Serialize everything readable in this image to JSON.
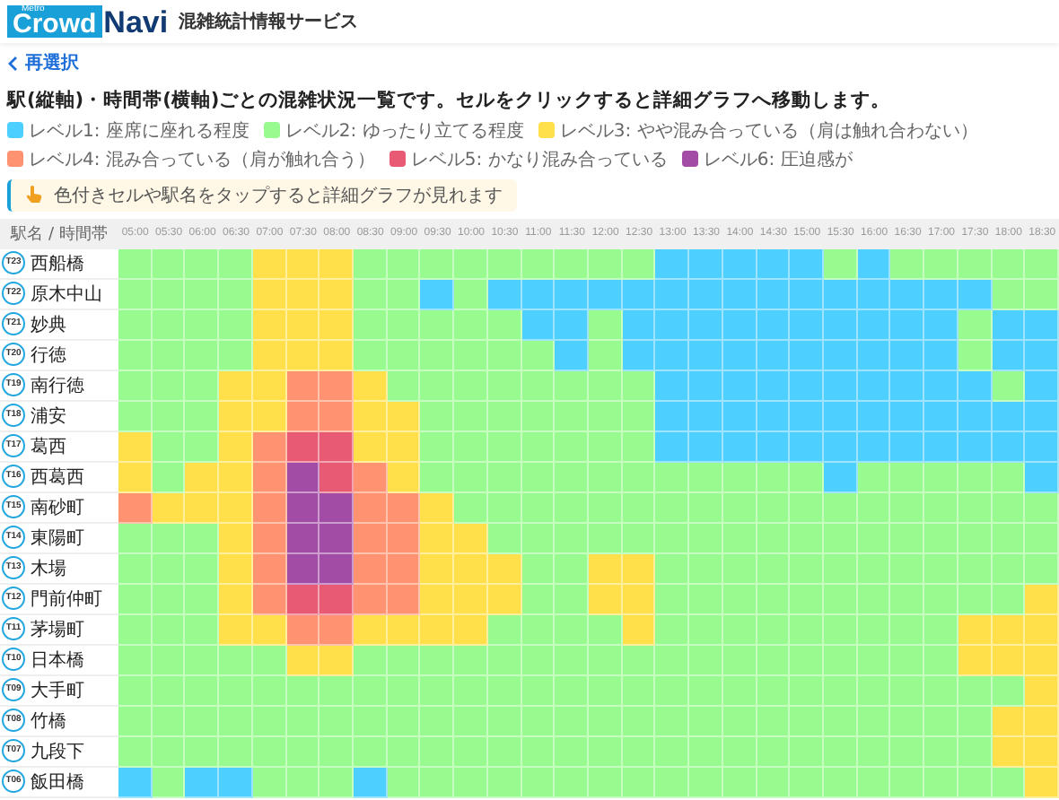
{
  "header": {
    "logo_tag": "Metro",
    "logo_main": "Crowd",
    "logo_accent": "Navi",
    "service_name": "混雑統計情報サービス"
  },
  "back_link": "再選択",
  "instruction": "駅(縦軸)・時間帯(横軸)ごとの混雑状況一覧です。セルをクリックすると詳細グラフへ移動します。",
  "legend": [
    {
      "label": "レベル1: 座席に座れる程度",
      "color": "#4dcfff"
    },
    {
      "label": "レベル2: ゆったり立てる程度",
      "color": "#98fb8f"
    },
    {
      "label": "レベル3: やや混み合っている（肩は触れ合わない）",
      "color": "#ffe04b"
    },
    {
      "label": "レベル4: 混み合っている（肩が触れ合う）",
      "color": "#ff9270"
    },
    {
      "label": "レベル5: かなり混み合っている",
      "color": "#e85a73"
    },
    {
      "label": "レベル6: 圧迫感が",
      "color": "#a24ca6"
    }
  ],
  "hint": "色付きセルや駅名をタップすると詳細グラフが見れます",
  "table": {
    "corner": "駅名 / 時間帯",
    "times": [
      "05:00",
      "05:30",
      "06:00",
      "06:30",
      "07:00",
      "07:30",
      "08:00",
      "08:30",
      "09:00",
      "09:30",
      "10:00",
      "10:30",
      "11:00",
      "11:30",
      "12:00",
      "12:30",
      "13:00",
      "13:30",
      "14:00",
      "14:30",
      "15:00",
      "15:30",
      "16:00",
      "16:30",
      "17:00",
      "17:30",
      "18:00",
      "18:30"
    ],
    "rows": [
      {
        "code": "T23",
        "station": "西船橋",
        "cells": [
          {
            "color": "#98fb8f"
          },
          {
            "color": "#98fb8f"
          },
          {
            "color": "#98fb8f"
          },
          {
            "color": "#98fb8f"
          },
          {
            "color": "#ffe04b"
          },
          {
            "color": "#ffe04b"
          },
          {
            "color": "#ffe04b"
          },
          {
            "color": "#98fb8f"
          },
          {
            "color": "#98fb8f"
          },
          {
            "color": "#98fb8f"
          },
          {
            "color": "#98fb8f"
          },
          {
            "color": "#98fb8f"
          },
          {
            "color": "#98fb8f"
          },
          {
            "color": "#98fb8f"
          },
          {
            "color": "#98fb8f"
          },
          {
            "color": "#98fb8f"
          },
          {
            "color": "#4dcfff"
          },
          {
            "color": "#4dcfff"
          },
          {
            "color": "#4dcfff"
          },
          {
            "color": "#4dcfff"
          },
          {
            "color": "#4dcfff"
          },
          {
            "color": "#98fb8f"
          },
          {
            "color": "#4dcfff"
          },
          {
            "color": "#98fb8f"
          },
          {
            "color": "#98fb8f"
          },
          {
            "color": "#98fb8f"
          },
          {
            "color": "#98fb8f"
          },
          {
            "color": "#98fb8f"
          }
        ]
      },
      {
        "code": "T22",
        "station": "原木中山",
        "cells": [
          {
            "color": "#98fb8f"
          },
          {
            "color": "#98fb8f"
          },
          {
            "color": "#98fb8f"
          },
          {
            "color": "#98fb8f"
          },
          {
            "color": "#ffe04b"
          },
          {
            "color": "#ffe04b"
          },
          {
            "color": "#ffe04b"
          },
          {
            "color": "#98fb8f"
          },
          {
            "color": "#98fb8f"
          },
          {
            "color": "#4dcfff"
          },
          {
            "color": "#98fb8f"
          },
          {
            "color": "#4dcfff"
          },
          {
            "color": "#4dcfff"
          },
          {
            "color": "#4dcfff"
          },
          {
            "color": "#4dcfff"
          },
          {
            "color": "#4dcfff"
          },
          {
            "color": "#4dcfff"
          },
          {
            "color": "#4dcfff"
          },
          {
            "color": "#4dcfff"
          },
          {
            "color": "#4dcfff"
          },
          {
            "color": "#4dcfff"
          },
          {
            "color": "#4dcfff"
          },
          {
            "color": "#4dcfff"
          },
          {
            "color": "#4dcfff"
          },
          {
            "color": "#4dcfff"
          },
          {
            "color": "#4dcfff"
          },
          {
            "color": "#98fb8f"
          },
          {
            "color": "#98fb8f"
          }
        ]
      },
      {
        "code": "T21",
        "station": "妙典",
        "cells": [
          {
            "color": "#98fb8f"
          },
          {
            "color": "#98fb8f"
          },
          {
            "color": "#98fb8f"
          },
          {
            "color": "#98fb8f"
          },
          {
            "color": "#ffe04b"
          },
          {
            "color": "#ffe04b"
          },
          {
            "color": "#ffe04b"
          },
          {
            "color": "#98fb8f"
          },
          {
            "color": "#98fb8f"
          },
          {
            "color": "#98fb8f"
          },
          {
            "color": "#98fb8f"
          },
          {
            "color": "#98fb8f"
          },
          {
            "color": "#4dcfff"
          },
          {
            "color": "#4dcfff"
          },
          {
            "color": "#98fb8f"
          },
          {
            "color": "#4dcfff"
          },
          {
            "color": "#4dcfff"
          },
          {
            "color": "#4dcfff"
          },
          {
            "color": "#4dcfff"
          },
          {
            "color": "#4dcfff"
          },
          {
            "color": "#4dcfff"
          },
          {
            "color": "#4dcfff"
          },
          {
            "color": "#4dcfff"
          },
          {
            "color": "#4dcfff"
          },
          {
            "color": "#4dcfff"
          },
          {
            "color": "#98fb8f"
          },
          {
            "color": "#4dcfff"
          },
          {
            "color": "#4dcfff"
          }
        ]
      },
      {
        "code": "T20",
        "station": "行徳",
        "cells": [
          {
            "color": "#98fb8f"
          },
          {
            "color": "#98fb8f"
          },
          {
            "color": "#98fb8f"
          },
          {
            "color": "#98fb8f"
          },
          {
            "color": "#ffe04b"
          },
          {
            "color": "#ffe04b"
          },
          {
            "color": "#ffe04b"
          },
          {
            "color": "#98fb8f"
          },
          {
            "color": "#98fb8f"
          },
          {
            "color": "#98fb8f"
          },
          {
            "color": "#98fb8f"
          },
          {
            "color": "#98fb8f"
          },
          {
            "color": "#98fb8f"
          },
          {
            "color": "#4dcfff"
          },
          {
            "color": "#98fb8f"
          },
          {
            "color": "#4dcfff"
          },
          {
            "color": "#4dcfff"
          },
          {
            "color": "#4dcfff"
          },
          {
            "color": "#4dcfff"
          },
          {
            "color": "#4dcfff"
          },
          {
            "color": "#4dcfff"
          },
          {
            "color": "#4dcfff"
          },
          {
            "color": "#4dcfff"
          },
          {
            "color": "#4dcfff"
          },
          {
            "color": "#4dcfff"
          },
          {
            "color": "#98fb8f"
          },
          {
            "color": "#4dcfff"
          },
          {
            "color": "#4dcfff"
          }
        ]
      },
      {
        "code": "T19",
        "station": "南行徳",
        "cells": [
          {
            "color": "#98fb8f"
          },
          {
            "color": "#98fb8f"
          },
          {
            "color": "#98fb8f"
          },
          {
            "color": "#ffe04b"
          },
          {
            "color": "#ffe04b"
          },
          {
            "color": "#ff9270"
          },
          {
            "color": "#ff9270"
          },
          {
            "color": "#ffe04b"
          },
          {
            "color": "#98fb8f"
          },
          {
            "color": "#98fb8f"
          },
          {
            "color": "#98fb8f"
          },
          {
            "color": "#98fb8f"
          },
          {
            "color": "#98fb8f"
          },
          {
            "color": "#98fb8f"
          },
          {
            "color": "#98fb8f"
          },
          {
            "color": "#98fb8f"
          },
          {
            "color": "#4dcfff"
          },
          {
            "color": "#4dcfff"
          },
          {
            "color": "#4dcfff"
          },
          {
            "color": "#4dcfff"
          },
          {
            "color": "#4dcfff"
          },
          {
            "color": "#4dcfff"
          },
          {
            "color": "#4dcfff"
          },
          {
            "color": "#4dcfff"
          },
          {
            "color": "#4dcfff"
          },
          {
            "color": "#4dcfff"
          },
          {
            "color": "#98fb8f"
          },
          {
            "color": "#4dcfff"
          }
        ]
      },
      {
        "code": "T18",
        "station": "浦安",
        "cells": [
          {
            "color": "#98fb8f"
          },
          {
            "color": "#98fb8f"
          },
          {
            "color": "#98fb8f"
          },
          {
            "color": "#ffe04b"
          },
          {
            "color": "#ffe04b"
          },
          {
            "color": "#ff9270"
          },
          {
            "color": "#ff9270"
          },
          {
            "color": "#ffe04b"
          },
          {
            "color": "#ffe04b"
          },
          {
            "color": "#98fb8f"
          },
          {
            "color": "#98fb8f"
          },
          {
            "color": "#98fb8f"
          },
          {
            "color": "#98fb8f"
          },
          {
            "color": "#98fb8f"
          },
          {
            "color": "#98fb8f"
          },
          {
            "color": "#98fb8f"
          },
          {
            "color": "#4dcfff"
          },
          {
            "color": "#4dcfff"
          },
          {
            "color": "#4dcfff"
          },
          {
            "color": "#4dcfff"
          },
          {
            "color": "#4dcfff"
          },
          {
            "color": "#4dcfff"
          },
          {
            "color": "#4dcfff"
          },
          {
            "color": "#4dcfff"
          },
          {
            "color": "#4dcfff"
          },
          {
            "color": "#4dcfff"
          },
          {
            "color": "#4dcfff"
          },
          {
            "color": "#4dcfff"
          }
        ]
      },
      {
        "code": "T17",
        "station": "葛西",
        "cells": [
          {
            "color": "#ffe04b"
          },
          {
            "color": "#98fb8f"
          },
          {
            "color": "#98fb8f"
          },
          {
            "color": "#ffe04b"
          },
          {
            "color": "#ff9270"
          },
          {
            "color": "#e85a73"
          },
          {
            "color": "#e85a73"
          },
          {
            "color": "#ffe04b"
          },
          {
            "color": "#ffe04b"
          },
          {
            "color": "#98fb8f"
          },
          {
            "color": "#98fb8f"
          },
          {
            "color": "#98fb8f"
          },
          {
            "color": "#98fb8f"
          },
          {
            "color": "#98fb8f"
          },
          {
            "color": "#98fb8f"
          },
          {
            "color": "#98fb8f"
          },
          {
            "color": "#4dcfff"
          },
          {
            "color": "#4dcfff"
          },
          {
            "color": "#4dcfff"
          },
          {
            "color": "#4dcfff"
          },
          {
            "color": "#4dcfff"
          },
          {
            "color": "#4dcfff"
          },
          {
            "color": "#4dcfff"
          },
          {
            "color": "#4dcfff"
          },
          {
            "color": "#4dcfff"
          },
          {
            "color": "#4dcfff"
          },
          {
            "color": "#4dcfff"
          },
          {
            "color": "#4dcfff"
          }
        ]
      },
      {
        "code": "T16",
        "station": "西葛西",
        "cells": [
          {
            "color": "#ffe04b"
          },
          {
            "color": "#98fb8f"
          },
          {
            "color": "#ffe04b"
          },
          {
            "color": "#ffe04b"
          },
          {
            "color": "#ff9270"
          },
          {
            "color": "#a24ca6"
          },
          {
            "color": "#e85a73"
          },
          {
            "color": "#ff9270"
          },
          {
            "color": "#ffe04b"
          },
          {
            "color": "#98fb8f"
          },
          {
            "color": "#98fb8f"
          },
          {
            "color": "#98fb8f"
          },
          {
            "color": "#98fb8f"
          },
          {
            "color": "#98fb8f"
          },
          {
            "color": "#98fb8f"
          },
          {
            "color": "#98fb8f"
          },
          {
            "color": "#98fb8f"
          },
          {
            "color": "#98fb8f"
          },
          {
            "color": "#98fb8f"
          },
          {
            "color": "#98fb8f"
          },
          {
            "color": "#98fb8f"
          },
          {
            "color": "#4dcfff"
          },
          {
            "color": "#98fb8f"
          },
          {
            "color": "#98fb8f"
          },
          {
            "color": "#98fb8f"
          },
          {
            "color": "#98fb8f"
          },
          {
            "color": "#98fb8f"
          },
          {
            "color": "#4dcfff"
          }
        ]
      },
      {
        "code": "T15",
        "station": "南砂町",
        "cells": [
          {
            "color": "#ff9270"
          },
          {
            "color": "#ffe04b"
          },
          {
            "color": "#ffe04b"
          },
          {
            "color": "#ffe04b"
          },
          {
            "color": "#ff9270"
          },
          {
            "color": "#a24ca6"
          },
          {
            "color": "#a24ca6"
          },
          {
            "color": "#ff9270"
          },
          {
            "color": "#ff9270"
          },
          {
            "color": "#ffe04b"
          },
          {
            "color": "#98fb8f"
          },
          {
            "color": "#98fb8f"
          },
          {
            "color": "#98fb8f"
          },
          {
            "color": "#98fb8f"
          },
          {
            "color": "#98fb8f"
          },
          {
            "color": "#98fb8f"
          },
          {
            "color": "#98fb8f"
          },
          {
            "color": "#98fb8f"
          },
          {
            "color": "#98fb8f"
          },
          {
            "color": "#98fb8f"
          },
          {
            "color": "#98fb8f"
          },
          {
            "color": "#98fb8f"
          },
          {
            "color": "#98fb8f"
          },
          {
            "color": "#98fb8f"
          },
          {
            "color": "#98fb8f"
          },
          {
            "color": "#98fb8f"
          },
          {
            "color": "#98fb8f"
          },
          {
            "color": "#98fb8f"
          }
        ]
      },
      {
        "code": "T14",
        "station": "東陽町",
        "cells": [
          {
            "color": "#98fb8f"
          },
          {
            "color": "#98fb8f"
          },
          {
            "color": "#98fb8f"
          },
          {
            "color": "#ffe04b"
          },
          {
            "color": "#ff9270"
          },
          {
            "color": "#a24ca6"
          },
          {
            "color": "#a24ca6"
          },
          {
            "color": "#ff9270"
          },
          {
            "color": "#ff9270"
          },
          {
            "color": "#ffe04b"
          },
          {
            "color": "#ffe04b"
          },
          {
            "color": "#98fb8f"
          },
          {
            "color": "#98fb8f"
          },
          {
            "color": "#98fb8f"
          },
          {
            "color": "#98fb8f"
          },
          {
            "color": "#98fb8f"
          },
          {
            "color": "#98fb8f"
          },
          {
            "color": "#98fb8f"
          },
          {
            "color": "#98fb8f"
          },
          {
            "color": "#98fb8f"
          },
          {
            "color": "#98fb8f"
          },
          {
            "color": "#98fb8f"
          },
          {
            "color": "#98fb8f"
          },
          {
            "color": "#98fb8f"
          },
          {
            "color": "#98fb8f"
          },
          {
            "color": "#98fb8f"
          },
          {
            "color": "#98fb8f"
          },
          {
            "color": "#98fb8f"
          }
        ]
      },
      {
        "code": "T13",
        "station": "木場",
        "cells": [
          {
            "color": "#98fb8f"
          },
          {
            "color": "#98fb8f"
          },
          {
            "color": "#98fb8f"
          },
          {
            "color": "#ffe04b"
          },
          {
            "color": "#ff9270"
          },
          {
            "color": "#a24ca6"
          },
          {
            "color": "#a24ca6"
          },
          {
            "color": "#ff9270"
          },
          {
            "color": "#ff9270"
          },
          {
            "color": "#ffe04b"
          },
          {
            "color": "#ffe04b"
          },
          {
            "color": "#ffe04b"
          },
          {
            "color": "#98fb8f"
          },
          {
            "color": "#98fb8f"
          },
          {
            "color": "#ffe04b"
          },
          {
            "color": "#ffe04b"
          },
          {
            "color": "#98fb8f"
          },
          {
            "color": "#98fb8f"
          },
          {
            "color": "#98fb8f"
          },
          {
            "color": "#98fb8f"
          },
          {
            "color": "#98fb8f"
          },
          {
            "color": "#98fb8f"
          },
          {
            "color": "#98fb8f"
          },
          {
            "color": "#98fb8f"
          },
          {
            "color": "#98fb8f"
          },
          {
            "color": "#98fb8f"
          },
          {
            "color": "#98fb8f"
          },
          {
            "color": "#98fb8f"
          }
        ]
      },
      {
        "code": "T12",
        "station": "門前仲町",
        "cells": [
          {
            "color": "#98fb8f"
          },
          {
            "color": "#98fb8f"
          },
          {
            "color": "#98fb8f"
          },
          {
            "color": "#ffe04b"
          },
          {
            "color": "#ff9270"
          },
          {
            "color": "#e85a73"
          },
          {
            "color": "#e85a73"
          },
          {
            "color": "#ff9270"
          },
          {
            "color": "#ff9270"
          },
          {
            "color": "#ffe04b"
          },
          {
            "color": "#ffe04b"
          },
          {
            "color": "#ffe04b"
          },
          {
            "color": "#98fb8f"
          },
          {
            "color": "#98fb8f"
          },
          {
            "color": "#ffe04b"
          },
          {
            "color": "#ffe04b"
          },
          {
            "color": "#98fb8f"
          },
          {
            "color": "#98fb8f"
          },
          {
            "color": "#98fb8f"
          },
          {
            "color": "#98fb8f"
          },
          {
            "color": "#98fb8f"
          },
          {
            "color": "#98fb8f"
          },
          {
            "color": "#98fb8f"
          },
          {
            "color": "#98fb8f"
          },
          {
            "color": "#98fb8f"
          },
          {
            "color": "#98fb8f"
          },
          {
            "color": "#98fb8f"
          },
          {
            "color": "#ffe04b"
          }
        ]
      },
      {
        "code": "T11",
        "station": "茅場町",
        "cells": [
          {
            "color": "#98fb8f"
          },
          {
            "color": "#98fb8f"
          },
          {
            "color": "#98fb8f"
          },
          {
            "color": "#ffe04b"
          },
          {
            "color": "#ffe04b"
          },
          {
            "color": "#ff9270"
          },
          {
            "color": "#ff9270"
          },
          {
            "color": "#ffe04b"
          },
          {
            "color": "#ffe04b"
          },
          {
            "color": "#ffe04b"
          },
          {
            "color": "#ffe04b"
          },
          {
            "color": "#98fb8f"
          },
          {
            "color": "#98fb8f"
          },
          {
            "color": "#98fb8f"
          },
          {
            "color": "#98fb8f"
          },
          {
            "color": "#ffe04b"
          },
          {
            "color": "#98fb8f"
          },
          {
            "color": "#98fb8f"
          },
          {
            "color": "#98fb8f"
          },
          {
            "color": "#98fb8f"
          },
          {
            "color": "#98fb8f"
          },
          {
            "color": "#98fb8f"
          },
          {
            "color": "#98fb8f"
          },
          {
            "color": "#98fb8f"
          },
          {
            "color": "#98fb8f"
          },
          {
            "color": "#ffe04b"
          },
          {
            "color": "#ffe04b"
          },
          {
            "color": "#ffe04b"
          }
        ]
      },
      {
        "code": "T10",
        "station": "日本橋",
        "cells": [
          {
            "color": "#98fb8f"
          },
          {
            "color": "#98fb8f"
          },
          {
            "color": "#98fb8f"
          },
          {
            "color": "#98fb8f"
          },
          {
            "color": "#98fb8f"
          },
          {
            "color": "#ffe04b"
          },
          {
            "color": "#ffe04b"
          },
          {
            "color": "#98fb8f"
          },
          {
            "color": "#98fb8f"
          },
          {
            "color": "#98fb8f"
          },
          {
            "color": "#98fb8f"
          },
          {
            "color": "#98fb8f"
          },
          {
            "color": "#98fb8f"
          },
          {
            "color": "#98fb8f"
          },
          {
            "color": "#98fb8f"
          },
          {
            "color": "#98fb8f"
          },
          {
            "color": "#98fb8f"
          },
          {
            "color": "#98fb8f"
          },
          {
            "color": "#98fb8f"
          },
          {
            "color": "#98fb8f"
          },
          {
            "color": "#98fb8f"
          },
          {
            "color": "#98fb8f"
          },
          {
            "color": "#98fb8f"
          },
          {
            "color": "#98fb8f"
          },
          {
            "color": "#98fb8f"
          },
          {
            "color": "#ffe04b"
          },
          {
            "color": "#ffe04b"
          },
          {
            "color": "#ffe04b"
          }
        ]
      },
      {
        "code": "T09",
        "station": "大手町",
        "cells": [
          {
            "color": "#98fb8f"
          },
          {
            "color": "#98fb8f"
          },
          {
            "color": "#98fb8f"
          },
          {
            "color": "#98fb8f"
          },
          {
            "color": "#98fb8f"
          },
          {
            "color": "#98fb8f"
          },
          {
            "color": "#98fb8f"
          },
          {
            "color": "#98fb8f"
          },
          {
            "color": "#98fb8f"
          },
          {
            "color": "#98fb8f"
          },
          {
            "color": "#98fb8f"
          },
          {
            "color": "#98fb8f"
          },
          {
            "color": "#98fb8f"
          },
          {
            "color": "#98fb8f"
          },
          {
            "color": "#98fb8f"
          },
          {
            "color": "#98fb8f"
          },
          {
            "color": "#98fb8f"
          },
          {
            "color": "#98fb8f"
          },
          {
            "color": "#98fb8f"
          },
          {
            "color": "#98fb8f"
          },
          {
            "color": "#98fb8f"
          },
          {
            "color": "#98fb8f"
          },
          {
            "color": "#98fb8f"
          },
          {
            "color": "#98fb8f"
          },
          {
            "color": "#98fb8f"
          },
          {
            "color": "#98fb8f"
          },
          {
            "color": "#98fb8f"
          },
          {
            "color": "#ffe04b"
          }
        ]
      },
      {
        "code": "T08",
        "station": "竹橋",
        "cells": [
          {
            "color": "#98fb8f"
          },
          {
            "color": "#98fb8f"
          },
          {
            "color": "#98fb8f"
          },
          {
            "color": "#98fb8f"
          },
          {
            "color": "#98fb8f"
          },
          {
            "color": "#98fb8f"
          },
          {
            "color": "#98fb8f"
          },
          {
            "color": "#98fb8f"
          },
          {
            "color": "#98fb8f"
          },
          {
            "color": "#98fb8f"
          },
          {
            "color": "#98fb8f"
          },
          {
            "color": "#98fb8f"
          },
          {
            "color": "#98fb8f"
          },
          {
            "color": "#98fb8f"
          },
          {
            "color": "#98fb8f"
          },
          {
            "color": "#98fb8f"
          },
          {
            "color": "#98fb8f"
          },
          {
            "color": "#98fb8f"
          },
          {
            "color": "#98fb8f"
          },
          {
            "color": "#98fb8f"
          },
          {
            "color": "#98fb8f"
          },
          {
            "color": "#98fb8f"
          },
          {
            "color": "#98fb8f"
          },
          {
            "color": "#98fb8f"
          },
          {
            "color": "#98fb8f"
          },
          {
            "color": "#98fb8f"
          },
          {
            "color": "#ffe04b"
          },
          {
            "color": "#ffe04b"
          }
        ]
      },
      {
        "code": "T07",
        "station": "九段下",
        "cells": [
          {
            "color": "#98fb8f"
          },
          {
            "color": "#98fb8f"
          },
          {
            "color": "#98fb8f"
          },
          {
            "color": "#98fb8f"
          },
          {
            "color": "#98fb8f"
          },
          {
            "color": "#98fb8f"
          },
          {
            "color": "#98fb8f"
          },
          {
            "color": "#98fb8f"
          },
          {
            "color": "#98fb8f"
          },
          {
            "color": "#98fb8f"
          },
          {
            "color": "#98fb8f"
          },
          {
            "color": "#98fb8f"
          },
          {
            "color": "#98fb8f"
          },
          {
            "color": "#98fb8f"
          },
          {
            "color": "#98fb8f"
          },
          {
            "color": "#98fb8f"
          },
          {
            "color": "#98fb8f"
          },
          {
            "color": "#98fb8f"
          },
          {
            "color": "#98fb8f"
          },
          {
            "color": "#98fb8f"
          },
          {
            "color": "#98fb8f"
          },
          {
            "color": "#98fb8f"
          },
          {
            "color": "#98fb8f"
          },
          {
            "color": "#98fb8f"
          },
          {
            "color": "#98fb8f"
          },
          {
            "color": "#98fb8f"
          },
          {
            "color": "#ffe04b"
          },
          {
            "color": "#ffe04b"
          }
        ]
      },
      {
        "code": "T06",
        "station": "飯田橋",
        "cells": [
          {
            "color": "#4dcfff"
          },
          {
            "color": "#98fb8f"
          },
          {
            "color": "#4dcfff"
          },
          {
            "color": "#4dcfff"
          },
          {
            "color": "#98fb8f"
          },
          {
            "color": "#98fb8f"
          },
          {
            "color": "#98fb8f"
          },
          {
            "color": "#4dcfff"
          },
          {
            "color": "#98fb8f"
          },
          {
            "color": "#98fb8f"
          },
          {
            "color": "#98fb8f"
          },
          {
            "color": "#98fb8f"
          },
          {
            "color": "#98fb8f"
          },
          {
            "color": "#98fb8f"
          },
          {
            "color": "#98fb8f"
          },
          {
            "color": "#98fb8f"
          },
          {
            "color": "#98fb8f"
          },
          {
            "color": "#98fb8f"
          },
          {
            "color": "#98fb8f"
          },
          {
            "color": "#98fb8f"
          },
          {
            "color": "#98fb8f"
          },
          {
            "color": "#98fb8f"
          },
          {
            "color": "#98fb8f"
          },
          {
            "color": "#98fb8f"
          },
          {
            "color": "#98fb8f"
          },
          {
            "color": "#98fb8f"
          },
          {
            "color": "#98fb8f"
          },
          {
            "color": "#ffe04b"
          }
        ]
      }
    ]
  }
}
